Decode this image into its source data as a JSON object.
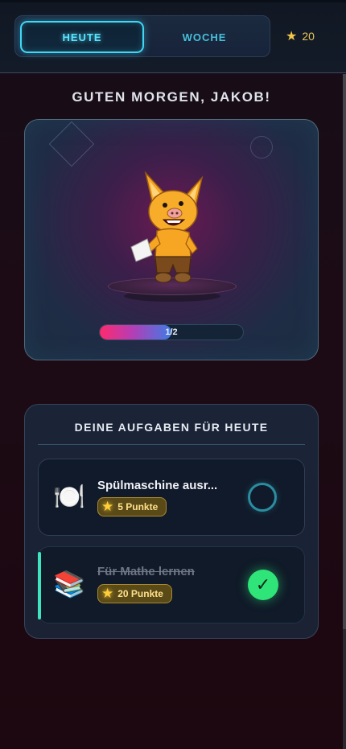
{
  "header": {
    "tabs": [
      {
        "label": "HEUTE",
        "active": true
      },
      {
        "label": "WOCHE",
        "active": false
      }
    ],
    "points": "20",
    "points_icon": "star-icon"
  },
  "greeting": "GUTEN MORGEN, JAKOB!",
  "hero": {
    "mascot_icon": "fox-mascot",
    "progress": {
      "label": "1/2",
      "fraction": 0.5
    }
  },
  "tasks": {
    "title": "DEINE AUFGABEN FÜR HEUTE",
    "items": [
      {
        "icon": "🍽️",
        "icon_name": "plate-cutlery-icon",
        "name": "Spülmaschine ausr...",
        "points": "5 Punkte",
        "done": false
      },
      {
        "icon": "📚",
        "icon_name": "books-icon",
        "name": "Für Mathe lernen",
        "points": "20 Punkte",
        "done": true
      }
    ]
  },
  "colors": {
    "accent_cyan": "#3fd7f5",
    "done_green": "#2fe478",
    "star_gold": "#f2c64a"
  }
}
